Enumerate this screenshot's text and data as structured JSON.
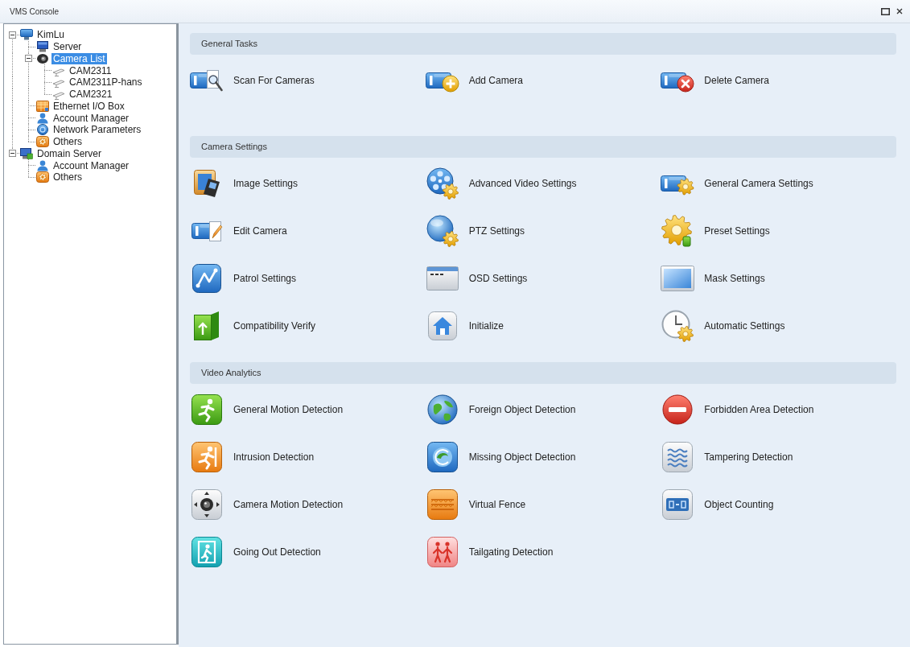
{
  "window": {
    "title": "VMS Console"
  },
  "tree": [
    {
      "label": "KimLu",
      "kind": "site",
      "selected": false,
      "expanded": true,
      "children": [
        {
          "label": "Server",
          "kind": "server",
          "selected": false
        },
        {
          "label": "Camera List",
          "kind": "camera-list",
          "selected": true,
          "expanded": true,
          "children": [
            {
              "label": "CAM2311",
              "kind": "camera",
              "selected": false
            },
            {
              "label": "CAM2311P-hans",
              "kind": "camera",
              "selected": false
            },
            {
              "label": "CAM2321",
              "kind": "camera",
              "selected": false
            }
          ]
        },
        {
          "label": "Ethernet I/O Box",
          "kind": "io-box",
          "selected": false
        },
        {
          "label": "Account Manager",
          "kind": "account",
          "selected": false
        },
        {
          "label": "Network Parameters",
          "kind": "network",
          "selected": false
        },
        {
          "label": "Others",
          "kind": "others",
          "selected": false
        }
      ]
    },
    {
      "label": "Domain Server",
      "kind": "domain",
      "selected": false,
      "expanded": true,
      "children": [
        {
          "label": "Account Manager",
          "kind": "account",
          "selected": false
        },
        {
          "label": "Others",
          "kind": "others",
          "selected": false
        }
      ]
    }
  ],
  "sections": [
    {
      "title": "General Tasks",
      "items": [
        "Scan For Cameras",
        "Add Camera",
        "Delete Camera"
      ]
    },
    {
      "title": "Camera Settings",
      "items": [
        "Image Settings",
        "Advanced Video Settings",
        "General Camera Settings",
        "Edit Camera",
        "PTZ Settings",
        "Preset Settings",
        "Patrol Settings",
        "OSD Settings",
        "Mask Settings",
        "Compatibility Verify",
        "Initialize",
        "Automatic Settings"
      ]
    },
    {
      "title": "Video Analytics",
      "items": [
        "General Motion Detection",
        "Foreign Object Detection",
        "Forbidden Area Detection",
        "Intrusion Detection",
        "Missing Object Detection",
        "Tampering Detection",
        "Camera Motion Detection",
        "Virtual Fence",
        "Object Counting",
        "Going Out Detection",
        "Tailgating Detection"
      ]
    }
  ]
}
